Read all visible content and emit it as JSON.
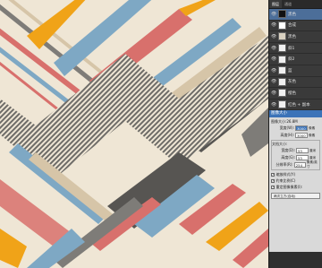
{
  "panel_tabs": [
    "图层",
    "通道"
  ],
  "layers": [
    {
      "name": "黑色",
      "thumb": "#111111",
      "selected": true
    },
    {
      "name": "合成",
      "thumb": "#ffffff"
    },
    {
      "name": "黑色",
      "thumb": "#d8d0c0"
    },
    {
      "name": "斜1",
      "thumb": "#f0f0f0"
    },
    {
      "name": "斜2",
      "thumb": "#f0f0f0"
    },
    {
      "name": "蓝",
      "thumb": "#f0f0f0"
    },
    {
      "name": "灰色",
      "thumb": "#f0f0f0"
    },
    {
      "name": "橙色",
      "thumb": "#f0f0f0"
    },
    {
      "name": "红色 + 副本",
      "thumb": "#f0f0f0"
    }
  ],
  "dialog": {
    "title": "图像大小",
    "image_size": "图像大小:26.8M",
    "width_label": "宽度(W):",
    "width_value": "3000",
    "height_label": "高度(H):",
    "height_value": "3000",
    "pixel_unit": "像素",
    "doc_size_label": "文档大小:",
    "doc_width_label": "宽度(D):",
    "doc_width_value": "53",
    "doc_height_label": "高度(G):",
    "doc_height_value": "53",
    "resolution_label": "分辨率(R):",
    "resolution_value": "254",
    "cm_unit": "厘米",
    "res_unit": "像素/英寸",
    "scale_styles": "缩放样式(Y)",
    "constrain": "约束比例(C)",
    "resample": "重定图像像素(I):",
    "resample_method": "两次立方(自动)"
  },
  "colors": {
    "bg": "#efe6d5",
    "blue": "#7ea8c4",
    "red": "#d8706c",
    "orange": "#f0a318",
    "grey": "#7e7c78",
    "tan": "#d6c5a8",
    "dark": "#575552"
  }
}
